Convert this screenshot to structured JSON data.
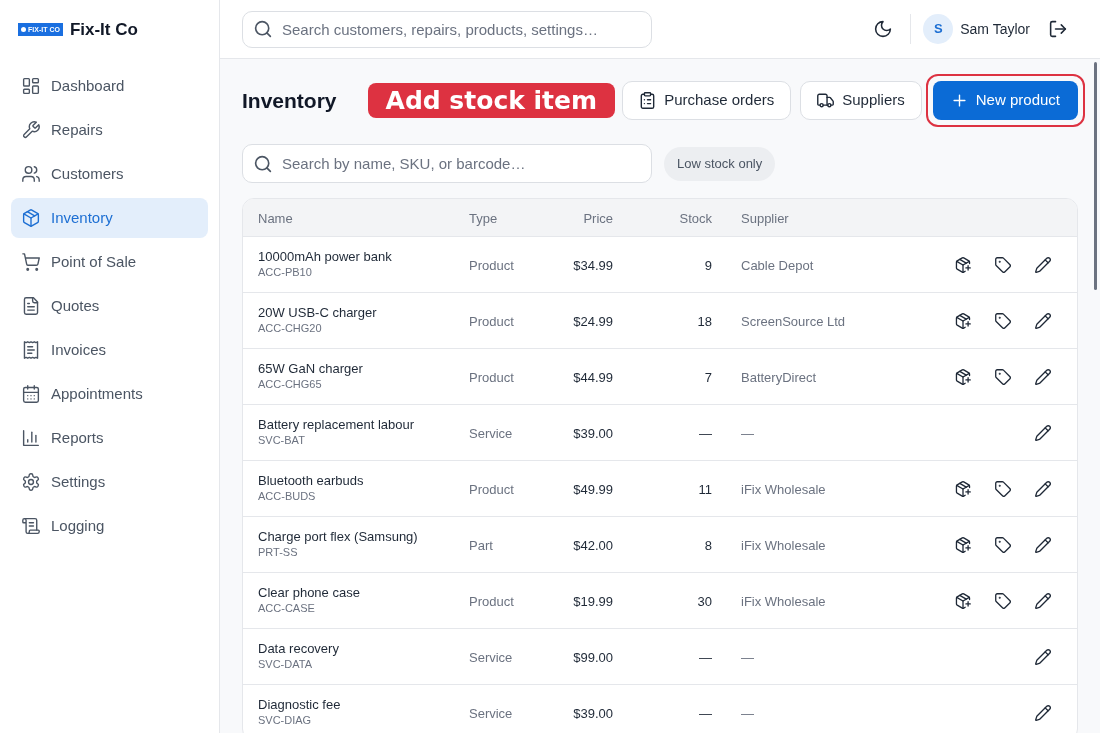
{
  "sidebar": {
    "logo": {
      "badge_text": "FIX-IT CO",
      "name": "Fix-It Co"
    },
    "items": [
      {
        "label": "Dashboard",
        "selected": false
      },
      {
        "label": "Repairs",
        "selected": false
      },
      {
        "label": "Customers",
        "selected": false
      },
      {
        "label": "Inventory",
        "selected": true
      },
      {
        "label": "Point of Sale",
        "selected": false
      },
      {
        "label": "Quotes",
        "selected": false
      },
      {
        "label": "Invoices",
        "selected": false
      },
      {
        "label": "Appointments",
        "selected": false
      },
      {
        "label": "Reports",
        "selected": false
      },
      {
        "label": "Settings",
        "selected": false
      },
      {
        "label": "Logging",
        "selected": false
      }
    ]
  },
  "topbar": {
    "search": {
      "placeholder": "Search customers, repairs, products, settings…"
    },
    "user": {
      "initial": "S",
      "name": "Sam Taylor"
    }
  },
  "page": {
    "title": "Inventory",
    "callout": "Add stock item",
    "actions": [
      {
        "label": "Purchase orders",
        "kind": "secondary",
        "highlighted": false
      },
      {
        "label": "Suppliers",
        "kind": "secondary",
        "highlighted": false
      },
      {
        "label": "New product",
        "kind": "primary",
        "highlighted": true
      }
    ]
  },
  "filters": {
    "search": {
      "placeholder": "Search by name, SKU, or barcode…"
    },
    "chips": [
      {
        "label": "Low stock only",
        "selected": false
      }
    ]
  },
  "table": {
    "columns": [
      "Name",
      "Type",
      "Price",
      "Stock",
      "Supplier"
    ],
    "rows": [
      {
        "name": "10000mAh power bank",
        "sku": "ACC-PB10",
        "type": "Product",
        "price": "$34.99",
        "stock": "9",
        "supplier": "Cable Depot",
        "actions": [
          {
            "kind": "receive"
          },
          {
            "kind": "tag"
          },
          {
            "kind": "edit"
          }
        ]
      },
      {
        "name": "20W USB-C charger",
        "sku": "ACC-CHG20",
        "type": "Product",
        "price": "$24.99",
        "stock": "18",
        "supplier": "ScreenSource Ltd",
        "actions": [
          {
            "kind": "receive"
          },
          {
            "kind": "tag"
          },
          {
            "kind": "edit"
          }
        ]
      },
      {
        "name": "65W GaN charger",
        "sku": "ACC-CHG65",
        "type": "Product",
        "price": "$44.99",
        "stock": "7",
        "supplier": "BatteryDirect",
        "actions": [
          {
            "kind": "receive"
          },
          {
            "kind": "tag"
          },
          {
            "kind": "edit"
          }
        ]
      },
      {
        "name": "Battery replacement labour",
        "sku": "SVC-BAT",
        "type": "Service",
        "price": "$39.00",
        "stock": "—",
        "supplier": "—",
        "actions": [
          {
            "kind": "edit"
          }
        ]
      },
      {
        "name": "Bluetooth earbuds",
        "sku": "ACC-BUDS",
        "type": "Product",
        "price": "$49.99",
        "stock": "11",
        "supplier": "iFix Wholesale",
        "actions": [
          {
            "kind": "receive"
          },
          {
            "kind": "tag"
          },
          {
            "kind": "edit"
          }
        ]
      },
      {
        "name": "Charge port flex (Samsung)",
        "sku": "PRT-SS",
        "type": "Part",
        "price": "$42.00",
        "stock": "8",
        "supplier": "iFix Wholesale",
        "actions": [
          {
            "kind": "receive"
          },
          {
            "kind": "tag"
          },
          {
            "kind": "edit"
          }
        ]
      },
      {
        "name": "Clear phone case",
        "sku": "ACC-CASE",
        "type": "Product",
        "price": "$19.99",
        "stock": "30",
        "supplier": "iFix Wholesale",
        "actions": [
          {
            "kind": "receive"
          },
          {
            "kind": "tag"
          },
          {
            "kind": "edit"
          }
        ]
      },
      {
        "name": "Data recovery",
        "sku": "SVC-DATA",
        "type": "Service",
        "price": "$99.00",
        "stock": "—",
        "supplier": "—",
        "actions": [
          {
            "kind": "edit"
          }
        ]
      },
      {
        "name": "Diagnostic fee",
        "sku": "SVC-DIAG",
        "type": "Service",
        "price": "$39.00",
        "stock": "—",
        "supplier": "—",
        "actions": [
          {
            "kind": "edit"
          }
        ]
      }
    ]
  }
}
